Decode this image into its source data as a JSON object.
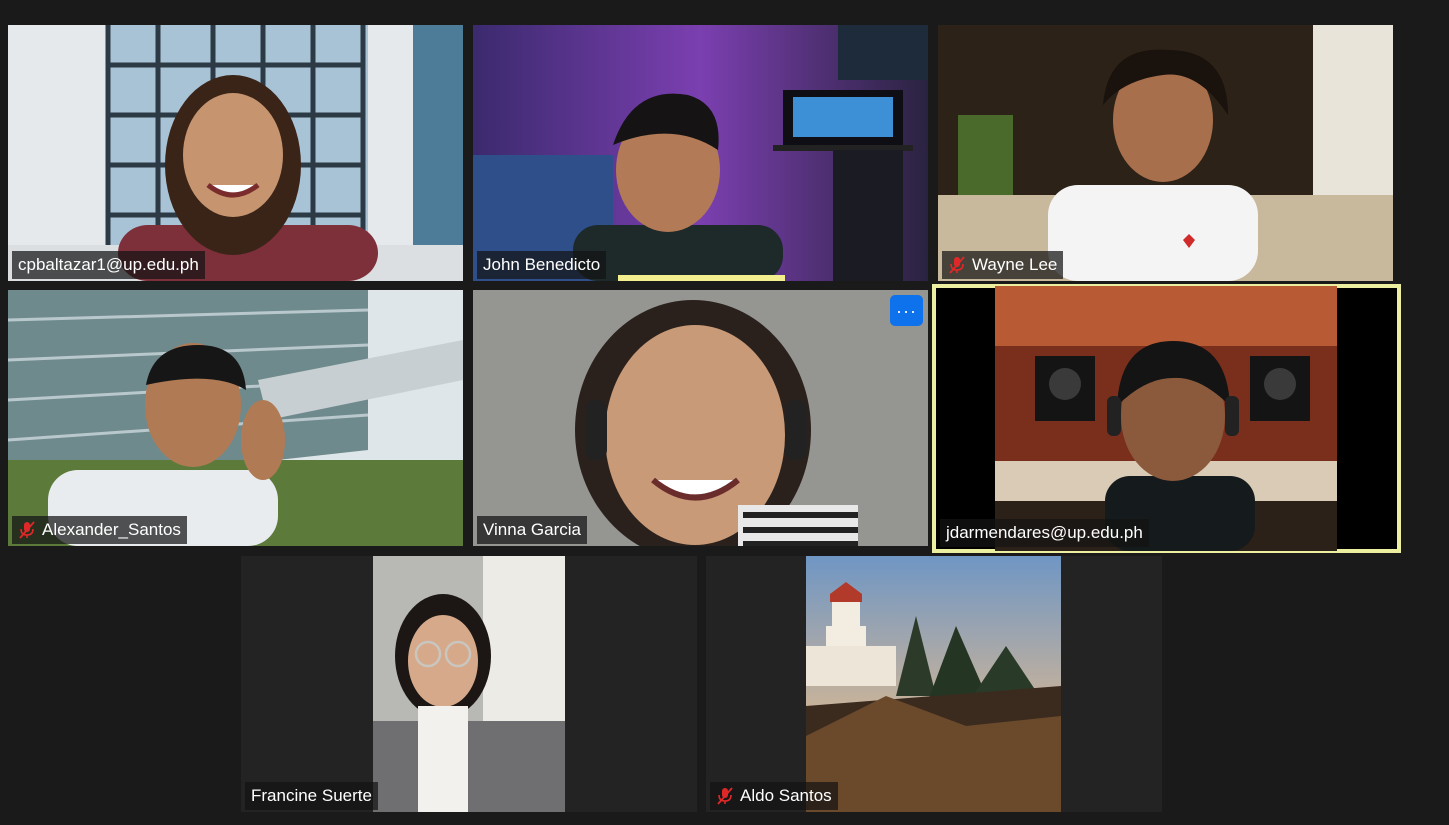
{
  "meeting": {
    "participants": [
      {
        "id": "p1",
        "name": "cpbaltazar1@up.edu.ph",
        "muted": false
      },
      {
        "id": "p2",
        "name": "John Benedicto",
        "muted": false
      },
      {
        "id": "p3",
        "name": "Wayne Lee",
        "muted": true
      },
      {
        "id": "p4",
        "name": "Alexander_Santos",
        "muted": true
      },
      {
        "id": "p5",
        "name": "Vinna Garcia",
        "muted": false,
        "more_label": "···"
      },
      {
        "id": "p6",
        "name": "jdarmendares@up.edu.ph",
        "muted": false,
        "active_speaker": true
      },
      {
        "id": "p7",
        "name": "Francine Suerte",
        "muted": false
      },
      {
        "id": "p8",
        "name": "Aldo Santos",
        "muted": true
      }
    ]
  },
  "colors": {
    "background": "#1a1a1a",
    "tile": "#232323",
    "active_speaker_border": "#ecef9f",
    "more_button": "#0e72ed",
    "mute_icon": "#e02828"
  },
  "icons": {
    "mute": "microphone-muted-icon",
    "more": "more-options-icon"
  }
}
